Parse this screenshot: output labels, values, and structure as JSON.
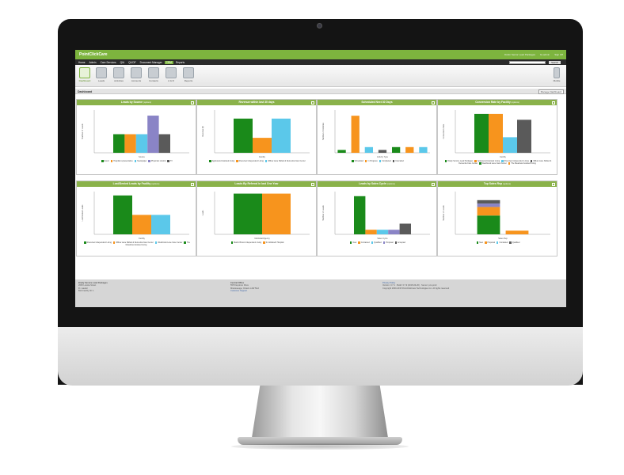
{
  "app": {
    "logo": "PointClickCare",
    "top_links": [
      "Dubin Senior Lead Packages",
      "bs.admin",
      "Sign Off"
    ],
    "nav": [
      "Home",
      "Admin",
      "Care Services",
      "QIA",
      "QLIDP",
      "Document Manager",
      "CRM",
      "Reports"
    ],
    "active_nav": "CRM",
    "search_placeholder": "",
    "search_label": "Search",
    "tools": [
      "Dashboard",
      "Leads",
      "Activities",
      "Accounts",
      "Contacts",
      "A & R",
      "Reports"
    ],
    "mobile_label": "Mobile",
    "page_title": "Dashboard",
    "manage_button": "Manage Dashboard"
  },
  "panels": [
    {
      "title": "Leads by Source",
      "sub": "(options)",
      "ylabel": "Number of Leads",
      "xlabel": "Source",
      "legend": [
        "Event",
        "Hospital representative",
        "Newspaper",
        "Physician referral",
        "TV"
      ]
    },
    {
      "title": "Revenue within last 30 days",
      "sub": "",
      "ylabel": "Revenue ($)",
      "xlabel": "Facility",
      "legend": [
        "Applewood Assisted Living",
        "Riverview Independent Living",
        "Willow Lane Skilled & Dementia Care Center"
      ]
    },
    {
      "title": "Scheduled Next 30 Days",
      "sub": "",
      "ylabel": "Number of Activities",
      "xlabel": "Activity Type",
      "legend": [
        "Scheduled",
        "In Progress",
        "Completed",
        "Cancelled"
      ]
    },
    {
      "title": "Conversion Rate by Facility",
      "sub": "(options)",
      "ylabel": "Conversion Rate",
      "xlabel": "Facility",
      "legend": [
        "Brady Service Lead Packages",
        "Applewood Assisted Living",
        "Riverview Independent Living",
        "Willow Lane Skilled & Dementia Care Center",
        "Westbrook Lane Care Center",
        "The Meadows Assisted Living"
      ]
    },
    {
      "title": "Lost/Denied Leads by Facility",
      "sub": "(options)",
      "ylabel": "Lost/Denied Leads",
      "xlabel": "Facility",
      "legend": [
        "Riverview Independent Living",
        "Willow Lane Skilled & Dementia Care Center",
        "Westbrook Lane Care Center",
        "The Meadows Assisted Living"
      ]
    },
    {
      "title": "Leads By Referral in last One Year",
      "sub": "",
      "ylabel": "Leads",
      "xlabel": "Individual/Agency",
      "legend": [
        "Martin Brown Independent Living",
        "St. Elizabeth Hospital"
      ]
    },
    {
      "title": "Leads by Sales Cycle",
      "sub": "(options)",
      "ylabel": "Number of Leads",
      "xlabel": "Sales Cycle",
      "legend": [
        "New",
        "Contacted",
        "Qualified",
        "Proposal",
        "Accepted"
      ]
    },
    {
      "title": "Top Sales Rep",
      "sub": "(options)",
      "ylabel": "Number of Leads",
      "xlabel": "Sales Rep",
      "legend": [
        "New",
        "Proposal",
        "Contacted",
        "Qualified"
      ]
    }
  ],
  "chart_data": [
    {
      "type": "bar",
      "categories": [
        "Event",
        "Hospital representative",
        "Newspaper",
        "Physician referral",
        "TV"
      ],
      "values": [
        2,
        2,
        2,
        4,
        2
      ],
      "ylim": [
        0,
        4.6
      ]
    },
    {
      "type": "bar",
      "categories": [
        "Applewood Assisted Living",
        "Riverview Independent Living",
        "Willow Lane Skilled & Dementia Care Center"
      ],
      "values": [
        16000,
        7000,
        16000
      ],
      "ylim": [
        0,
        20000
      ],
      "yticks": [
        "0",
        "2,000",
        "4,000",
        "6,000",
        "8,000",
        "10,000",
        "12,000",
        "14,000",
        "16,000",
        "18,000",
        "20,000"
      ]
    },
    {
      "type": "bar",
      "categories": [
        "Nov",
        "Dec",
        "Jan",
        "Feb",
        "Mar",
        "Apr",
        "May"
      ],
      "values": [
        1,
        13,
        2,
        1,
        2,
        2,
        2
      ],
      "ylim": [
        0,
        15
      ]
    },
    {
      "type": "bar",
      "categories": [
        "Brady Service Lead Packages",
        "Applewood Assisted Living",
        "Riverview Independent Living",
        "The Meadows Assisted Living"
      ],
      "values": [
        100,
        100,
        40,
        85
      ],
      "ylim": [
        0,
        110
      ]
    },
    {
      "type": "bar",
      "categories": [
        "Riverview Independent Living",
        "Willow Lane Skilled & Dementia Care Center",
        "Westbrook Lane Care Center"
      ],
      "values": [
        4,
        2,
        2
      ],
      "ylim": [
        0,
        4.4
      ]
    },
    {
      "type": "bar",
      "categories": [
        "Martin Brown Independent Living",
        "St. Elizabeth Hospital"
      ],
      "values": [
        1,
        1
      ],
      "ylim": [
        0,
        1.05
      ]
    },
    {
      "type": "bar",
      "categories": [
        "New",
        "Contacted",
        "Qualified",
        "Proposal",
        "Accepted"
      ],
      "values": [
        25,
        3,
        3,
        3,
        7
      ],
      "ylim": [
        0,
        28
      ]
    },
    {
      "type": "bar",
      "categories": [
        "bs.admin",
        "jsmith"
      ],
      "values": [
        28,
        3
      ],
      "ylim": [
        0,
        35
      ]
    }
  ],
  "footer": {
    "col1": [
      "Brady Service Lead Packages",
      "2045 Loretta Street",
      "Ft. Lauder",
      "",
      "Bob Facility ID: 1"
    ],
    "col2": [
      "Central Office",
      "5570 Explorer Drive",
      "Mississauga, Ontario L4W 5G2",
      "Customer Support"
    ],
    "col3": [
      "Privacy Policy",
      "Version: 3.7.1 · Build: 3.7.9 (2015-03-20) · Server: pcc-prod",
      "Copyright 2000-2015 PointClickCare Technologies Inc. All rights reserved"
    ]
  },
  "colors": {
    "green": "#1a8a1a",
    "orange": "#f7941d",
    "cyan": "#5bc8ea",
    "purple": "#8a84c6",
    "gray": "#5a5a5a",
    "brand": "#7db43e",
    "panel_header": "#8ab24a"
  }
}
